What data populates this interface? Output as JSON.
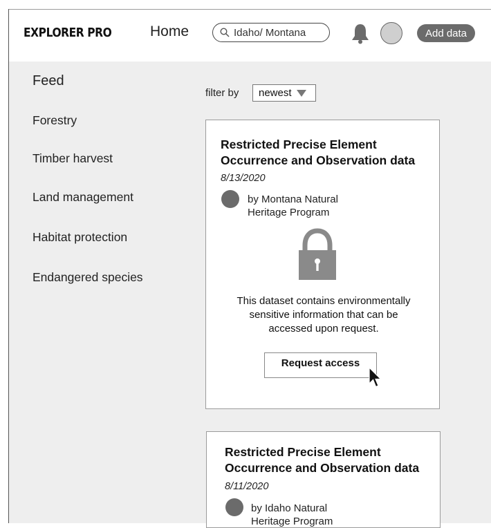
{
  "header": {
    "brand": "EXPLORER PRO",
    "nav_home": "Home",
    "search": {
      "value": "Idaho/ Montana"
    },
    "add_data_label": "Add data"
  },
  "sidebar": {
    "title": "Feed",
    "items": [
      {
        "label": "Forestry"
      },
      {
        "label": "Timber harvest"
      },
      {
        "label": "Land management"
      },
      {
        "label": "Habitat protection"
      },
      {
        "label": "Endangered species"
      }
    ]
  },
  "filter": {
    "label": "filter by",
    "selected": "newest"
  },
  "cards": [
    {
      "title_line1": "Restricted Precise Element",
      "title_line2": "Occurrence and Observation data",
      "date": "8/13/2020",
      "publisher_line1": "by Montana Natural",
      "publisher_line2": "Heritage Program",
      "lock_icon": "lock-icon",
      "notice_line1": "This dataset contains environmentally",
      "notice_line2": "sensitive information that can be",
      "notice_line3": "accessed upon request.",
      "button_label": "Request access"
    },
    {
      "title_line1": "Restricted Precise Element",
      "title_line2": "Occurrence and Observation data",
      "date": "8/11/2020",
      "publisher_line1": "by Idaho Natural",
      "publisher_line2": "Heritage Program"
    }
  ],
  "colors": {
    "content_bg": "#eeeeee",
    "dark_gray": "#6b6b6b",
    "lock_gray": "#8a8a8a"
  }
}
